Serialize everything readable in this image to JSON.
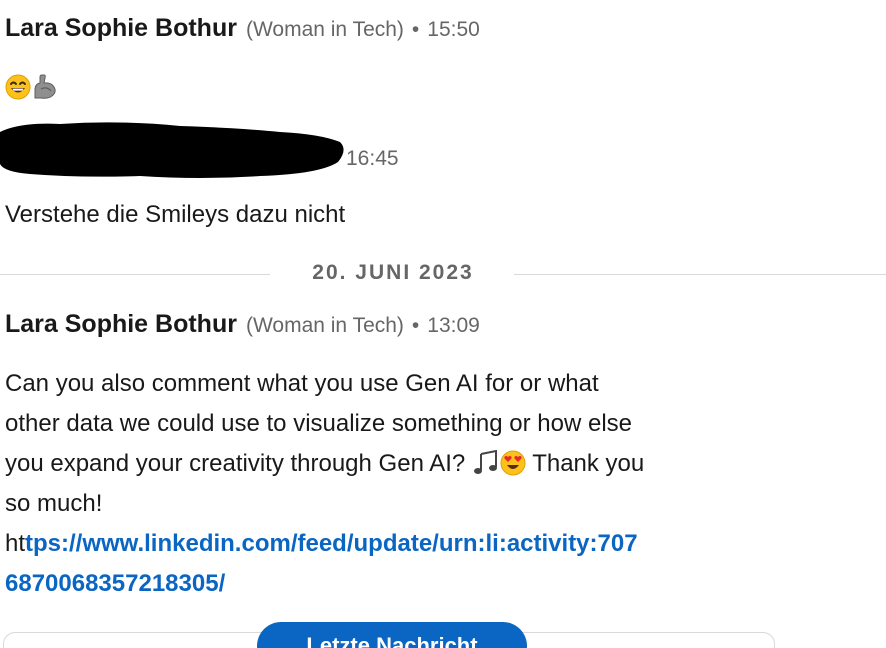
{
  "messages": [
    {
      "sender": "Lara Sophie Bothur",
      "headline": "(Woman in Tech)",
      "separator": "•",
      "time": "15:50",
      "body_emojis": [
        "grinning-face-smiling-eyes",
        "flexed-biceps"
      ]
    },
    {
      "sender_redacted": true,
      "time_visible_part": "16:45",
      "body": "Verstehe die Smileys dazu nicht"
    }
  ],
  "date_divider": "20. JUNI 2023",
  "message3": {
    "sender": "Lara Sophie Bothur",
    "headline": "(Woman in Tech)",
    "separator": "•",
    "time": "13:09",
    "line1": "Can you also comment what you use Gen AI for or what",
    "line2": "other data we could use to visualize something or how else",
    "line3_start": "you expand your creativity through Gen AI?",
    "line3_emojis": [
      "musical-notes",
      "smiling-face-heart-eyes"
    ],
    "line3_end": "Thank you",
    "line4": "so much!",
    "link_prefix": "ht",
    "link_line1": "tps://www.linkedin.com/feed/update/urn:li:activity:707",
    "link_line2": "6870068357218305/"
  },
  "jump_button_label": "Letzte Nachricht",
  "colors": {
    "link": "#0a66c2",
    "button": "#0a66c2",
    "meta_gray": "#666666",
    "divider": "#d9d9d9"
  }
}
